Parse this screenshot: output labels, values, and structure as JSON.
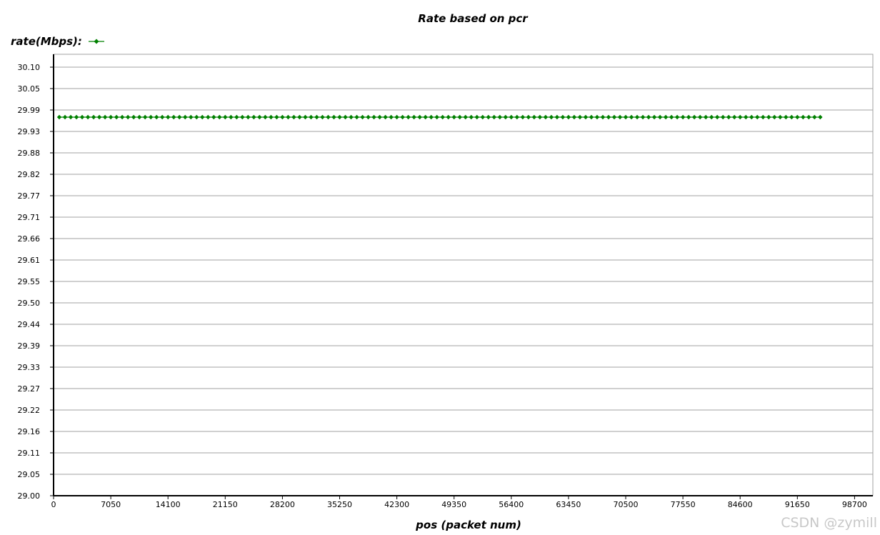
{
  "chart_data": {
    "type": "line",
    "title": "Rate based on pcr",
    "ylabel": "rate(Mbps):",
    "xlabel": "pos (packet num)",
    "ylim": [
      29.0,
      30.13
    ],
    "xlim": [
      0,
      102000
    ],
    "ytick_labels": [
      "29.00",
      "29.05",
      "29.11",
      "29.16",
      "29.22",
      "29.27",
      "29.33",
      "29.39",
      "29.44",
      "29.50",
      "29.55",
      "29.61",
      "29.66",
      "29.71",
      "29.77",
      "29.82",
      "29.88",
      "29.93",
      "29.99",
      "30.05",
      "30.10"
    ],
    "xticks": [
      0,
      7050,
      14100,
      21150,
      28200,
      35250,
      42300,
      49350,
      56400,
      63450,
      70500,
      77550,
      84600,
      91650,
      98700
    ],
    "grid": true,
    "legend": "top-left",
    "series": [
      {
        "name": "",
        "color": "#008000",
        "marker": "diamond",
        "x_start": 705,
        "x_step": 705,
        "count": 134,
        "y": 29.97
      }
    ]
  },
  "watermark": "CSDN @zymill"
}
